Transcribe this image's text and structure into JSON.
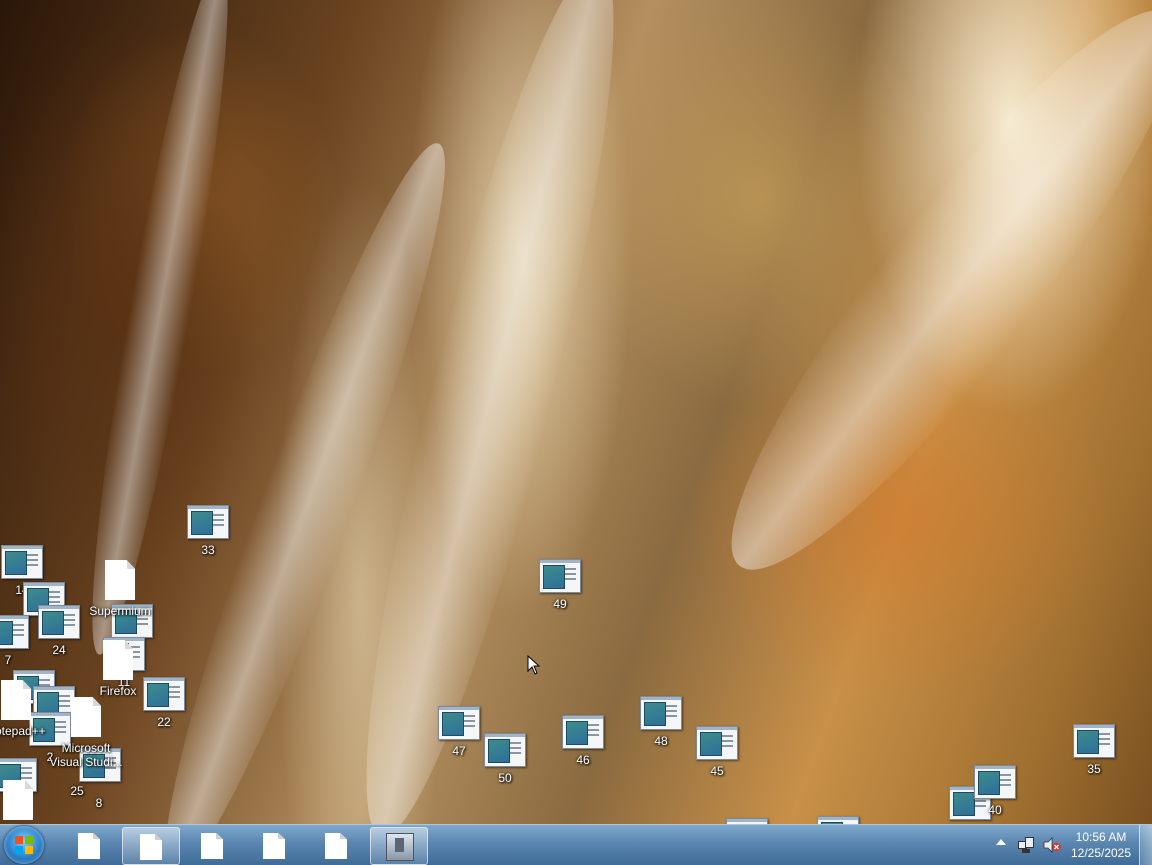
{
  "desktop_icons": {
    "i33": "33",
    "i14": "14",
    "i24": "24",
    "i7": "7",
    "i11": "11",
    "i22": "22",
    "i2": "2",
    "i25": "25",
    "i8": "8",
    "i40": "40",
    "i47": "47",
    "i50": "50",
    "i46": "46",
    "i48": "48",
    "i45": "45",
    "i49": "49",
    "i35": "35",
    "supermium": "Supermium",
    "firefox": "Firefox",
    "notepadpp": "Notepad++",
    "vscode": "Microsoft Visual Studi..."
  },
  "taskbar": {
    "clock_time": "10:56 AM",
    "clock_date": "12/25/2025"
  },
  "colors": {
    "taskbar_top": "#7fa8cc",
    "taskbar_bottom": "#3f6b98",
    "icon_label": "#ffffff"
  }
}
